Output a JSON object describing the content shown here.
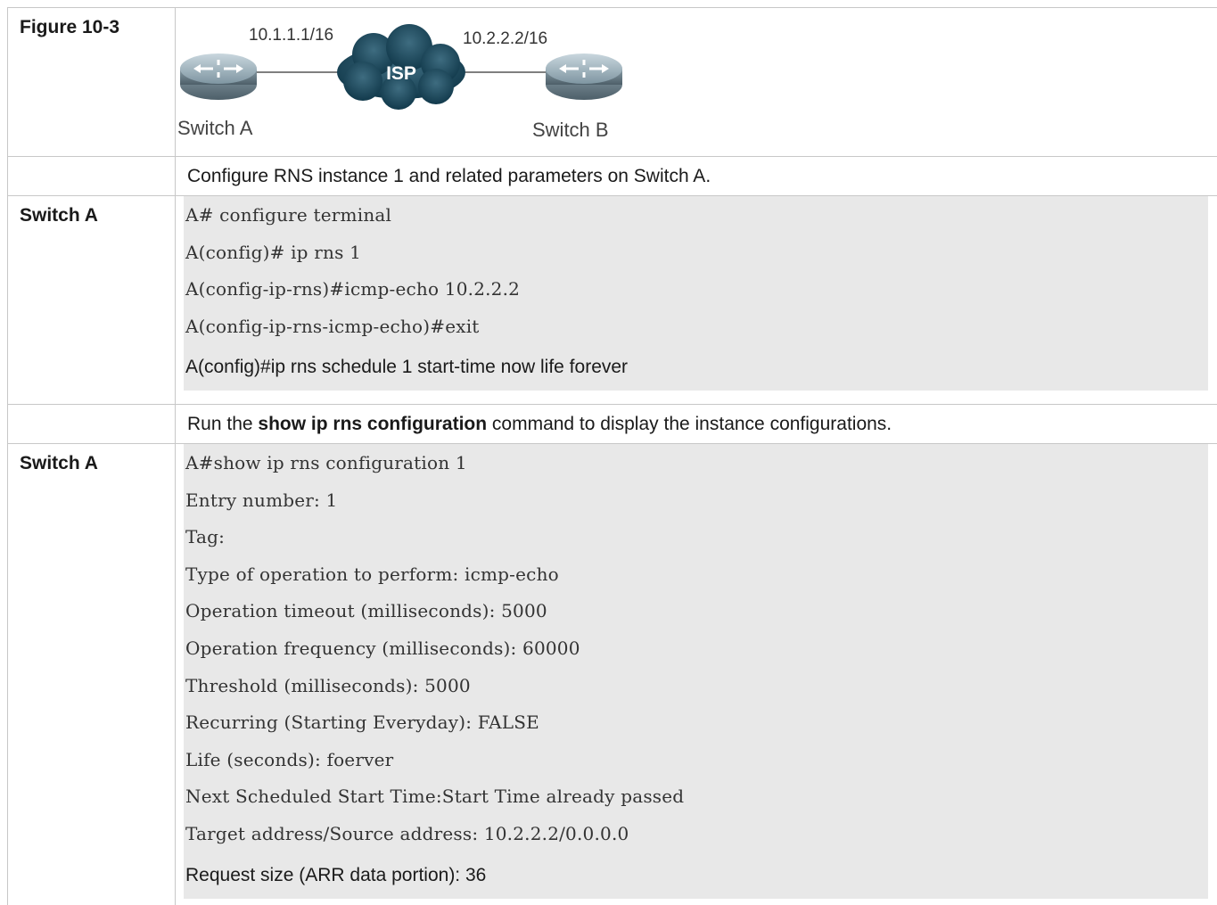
{
  "figure": {
    "label": "Figure 10-3",
    "ip_left": "10.1.1.1/16",
    "ip_right": "10.2.2.2/16",
    "cloud_label": "ISP",
    "switch_a": "Switch A",
    "switch_b": "Switch B"
  },
  "step1": {
    "text": "Configure RNS instance 1 and related parameters on Switch A."
  },
  "config_block": {
    "label": "Switch A",
    "lines": [
      "A# configure terminal",
      "A(config)# ip rns 1",
      "A(config-ip-rns)#icmp-echo 10.2.2.2",
      "A(config-ip-rns-icmp-echo)#exit"
    ],
    "last_line": "A(config)#ip rns schedule 1 start-time now life forever"
  },
  "step2": {
    "prefix": "Run the ",
    "command": "show ip rns configuration",
    "suffix": " command to display the instance configurations."
  },
  "show_block": {
    "label": "Switch A",
    "lines": [
      "A#show ip rns configuration 1",
      "Entry number: 1",
      "Tag:",
      "Type of operation to perform: icmp-echo",
      "Operation timeout (milliseconds): 5000",
      "Operation frequency (milliseconds): 60000",
      "Threshold (milliseconds): 5000",
      "Recurring (Starting Everyday): FALSE",
      "Life (seconds): foerver",
      "Next Scheduled Start Time:Start Time already passed",
      "Target address/Source address: 10.2.2.2/0.0.0.0"
    ],
    "last_line": "Request size (ARR data portion): 36"
  }
}
